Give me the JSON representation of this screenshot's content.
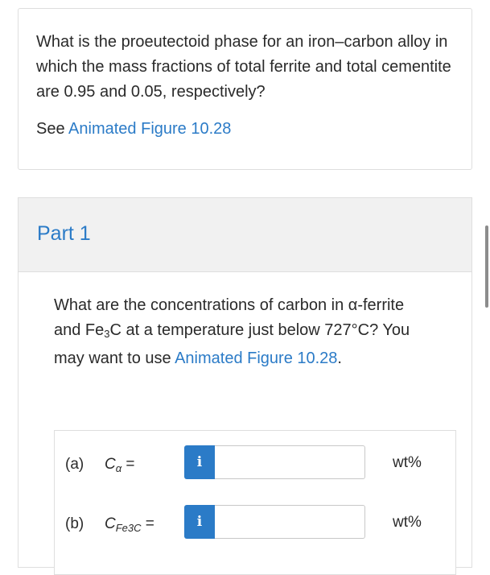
{
  "question": {
    "text": "What is the proeutectoid phase for an iron–carbon alloy in which the mass fractions of total ferrite and total cementite are 0.95 and 0.05, respectively?",
    "see_prefix": "See ",
    "see_link": "Animated Figure 10.28"
  },
  "part": {
    "title": "Part 1",
    "question_pre": "What are the concentrations of carbon in α-ferrite and Fe",
    "question_sub": "3",
    "question_mid": "C at a temperature just below 727°C? You may want to use ",
    "question_link": "Animated Figure 10.28",
    "question_end": "."
  },
  "answers": [
    {
      "label": "(a)",
      "var": "C",
      "var_sub": "α",
      "eq": " =",
      "info": "i",
      "value": "",
      "unit": "wt%"
    },
    {
      "label": "(b)",
      "var": "C",
      "var_sub": "Fe3C",
      "eq": " =",
      "info": "i",
      "value": "",
      "unit": "wt%"
    }
  ],
  "colors": {
    "accent": "#2b7bc7",
    "header_bg": "#f1f1f1"
  }
}
